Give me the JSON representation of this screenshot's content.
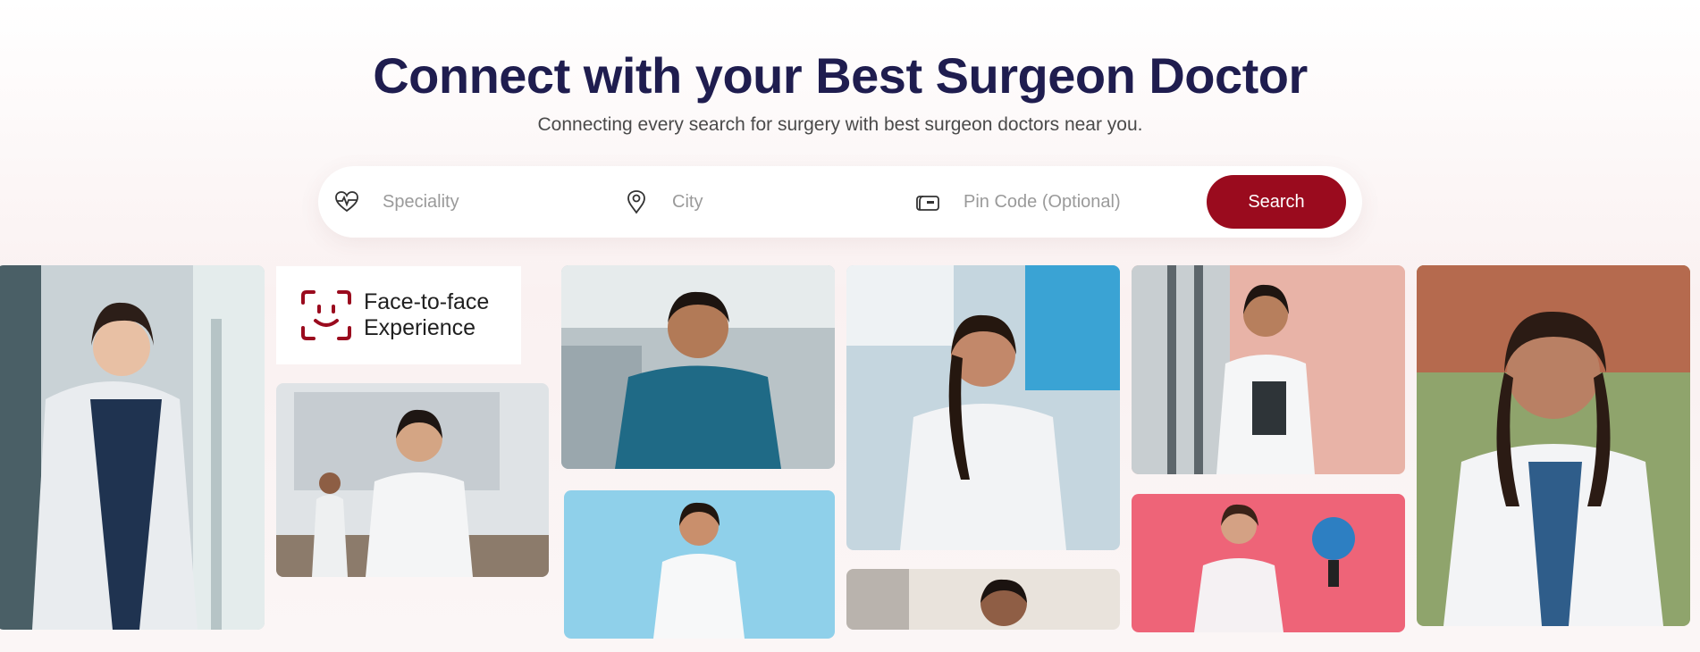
{
  "hero": {
    "title": "Connect with your Best Surgeon Doctor",
    "subtitle": "Connecting every search for surgery with best surgeon doctors near you."
  },
  "search": {
    "speciality_placeholder": "Speciality",
    "city_placeholder": "City",
    "pincode_placeholder": "Pin Code (Optional)",
    "button_label": "Search",
    "icons": [
      "heart-pulse-icon",
      "location-pin-icon",
      "postbox-icon"
    ]
  },
  "feature_card": {
    "line1": "Face-to-face",
    "line2": "Experience",
    "icon": "face-scan-icon"
  },
  "colors": {
    "title": "#1f1d4f",
    "accent": "#9a0b1e",
    "background": "#faf1f1"
  }
}
